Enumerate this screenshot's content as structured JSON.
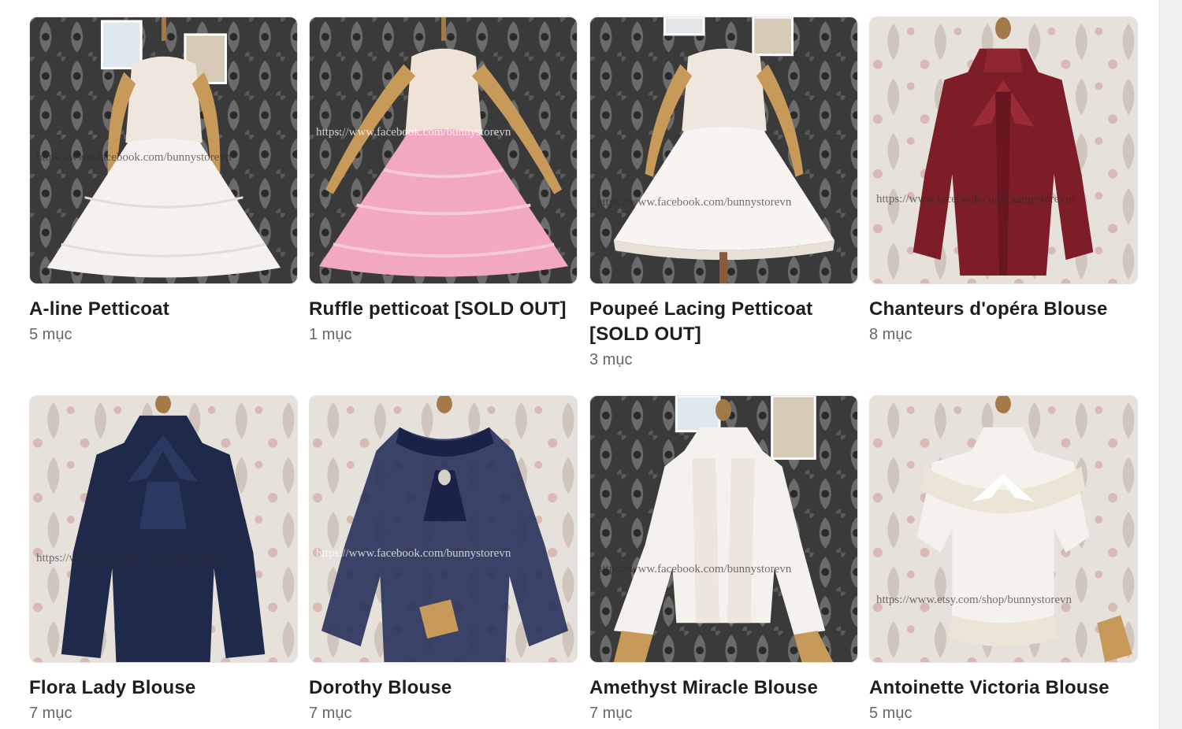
{
  "albums": [
    {
      "title": "A-line Petticoat",
      "count": "5 mục",
      "watermark": "https://www.facebook.com/bunnystorevn",
      "icon": "petticoat-image"
    },
    {
      "title": "Ruffle petticoat [SOLD OUT]",
      "count": "1 mục",
      "watermark": "https://www.facebook.com/bunnystorevn",
      "icon": "petticoat-image"
    },
    {
      "title": "Poupeé Lacing Petticoat [SOLD OUT]",
      "count": "3 mục",
      "watermark": "https://www.facebook.com/bunnystorevn",
      "icon": "petticoat-image"
    },
    {
      "title": "Chanteurs d'opéra Blouse",
      "count": "8 mục",
      "watermark": "https://www.facebook.com/bunnystorevn/",
      "icon": "blouse-image"
    },
    {
      "title": "Flora Lady Blouse",
      "count": "7 mục",
      "watermark": "https://www.facebook.com/bunnystorevn",
      "icon": "blouse-image"
    },
    {
      "title": "Dorothy Blouse",
      "count": "7 mục",
      "watermark": "https://www.facebook.com/bunnystorevn",
      "icon": "blouse-image"
    },
    {
      "title": "Amethyst Miracle Blouse",
      "count": "7 mục",
      "watermark": "https://www.facebook.com/bunnystorevn",
      "icon": "blouse-image"
    },
    {
      "title": "Antoinette Victoria Blouse",
      "count": "5 mục",
      "watermark": "https://www.etsy.com/shop/bunnystorevn",
      "icon": "blouse-image"
    }
  ],
  "colors": {
    "damask_dark": "#3a3a3a",
    "damask_light": "#d9d2cb",
    "petticoat_white": "#f4f1ef",
    "petticoat_pink": "#f2a7c3",
    "blouse_wine": "#7c1d28",
    "blouse_navy": "#1f2a4a",
    "blouse_sheer_navy": "#27315a",
    "blouse_cream": "#f5f2ee",
    "title_text": "#1c1e21",
    "muted_text": "#65676b"
  }
}
